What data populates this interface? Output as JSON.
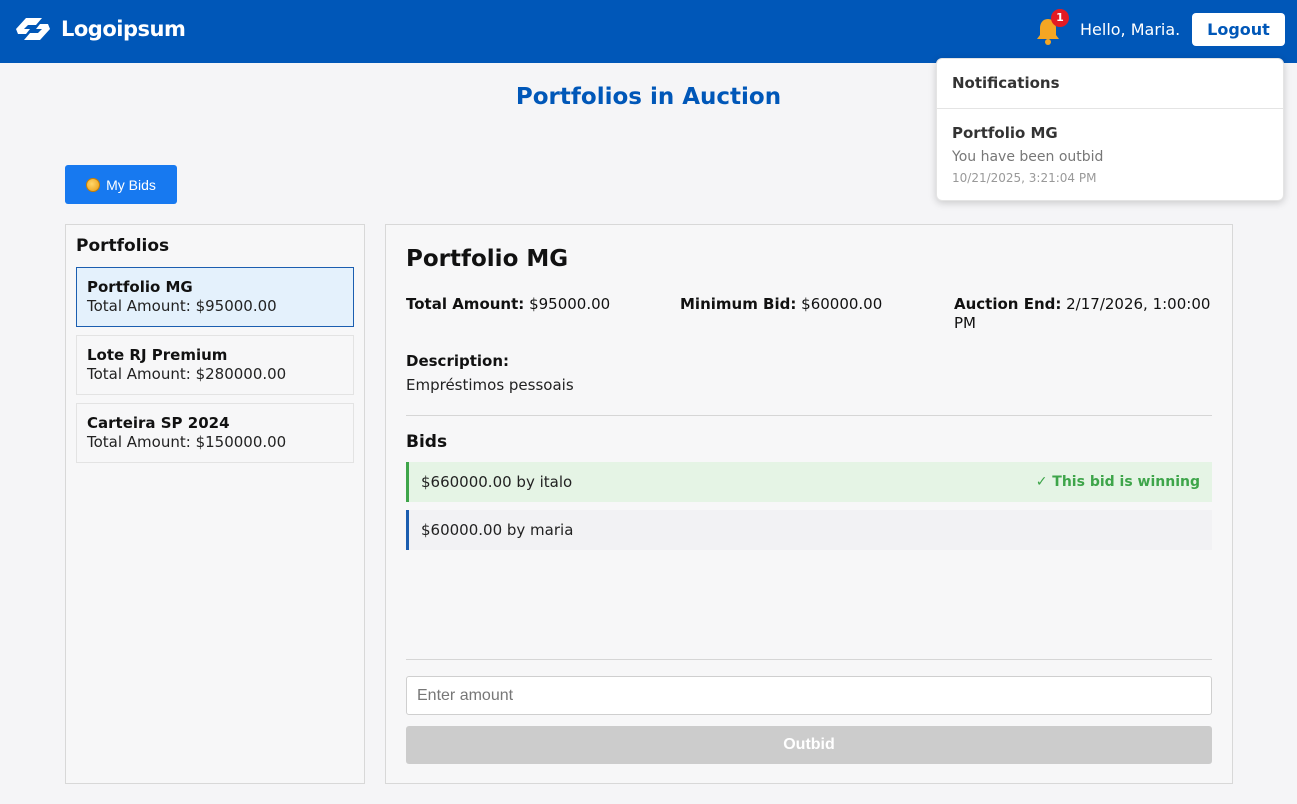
{
  "header": {
    "brand": "Logoipsum",
    "notification_count": "1",
    "greeting": "Hello, Maria.",
    "logout_label": "Logout",
    "colors": {
      "bar": "#0057b8",
      "badge": "#e31b23",
      "bell": "#f4a623"
    }
  },
  "page": {
    "title": "Portfolios in Auction"
  },
  "my_bids": {
    "label": "My Bids",
    "icon": "coin-icon"
  },
  "sidebar": {
    "title": "Portfolios",
    "items": [
      {
        "name": "Portfolio MG",
        "amount": "Total Amount: $95000.00",
        "selected": true
      },
      {
        "name": "Lote RJ Premium",
        "amount": "Total Amount: $280000.00",
        "selected": false
      },
      {
        "name": "Carteira SP 2024",
        "amount": "Total Amount: $150000.00",
        "selected": false
      }
    ]
  },
  "detail": {
    "title": "Portfolio MG",
    "total_label": "Total Amount:",
    "total_value": "$95000.00",
    "min_bid_label": "Minimum Bid:",
    "min_bid_value": "$60000.00",
    "end_label": "Auction End:",
    "end_value": "2/17/2026, 1:00:00 PM",
    "description_label": "Description:",
    "description_value": "Empréstimos pessoais",
    "bids_title": "Bids",
    "bids": [
      {
        "text": "$660000.00 by italo",
        "status": "✓ This bid is winning",
        "winning": true
      },
      {
        "text": "$60000.00 by maria",
        "status": "",
        "winning": false
      }
    ],
    "amount_placeholder": "Enter amount",
    "outbid_label": "Outbid"
  },
  "notifications": {
    "title": "Notifications",
    "items": [
      {
        "title": "Portfolio MG",
        "message": "You have been outbid",
        "time": "10/21/2025, 3:21:04 PM"
      }
    ]
  }
}
